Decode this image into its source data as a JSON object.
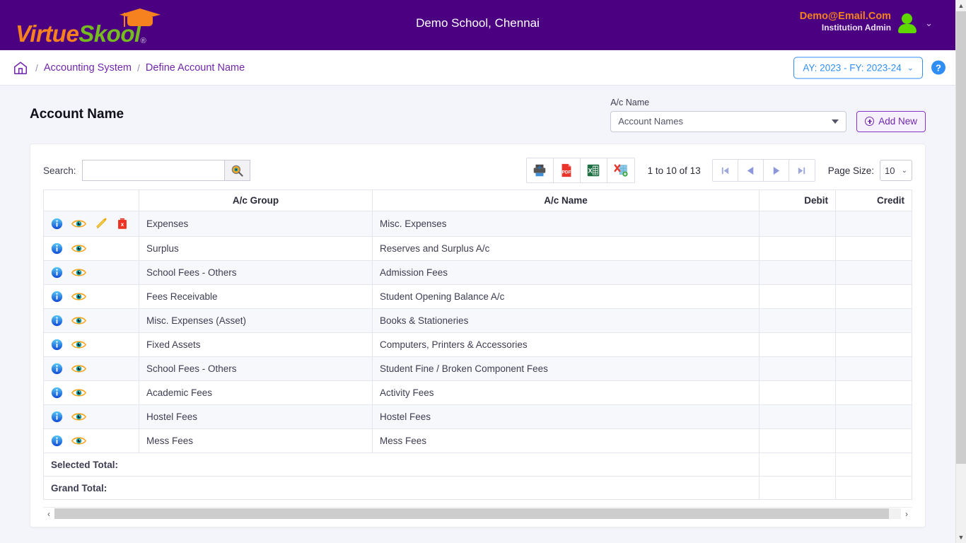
{
  "topbar": {
    "brand_part1": "Virtue",
    "brand_part2": "Skool",
    "brand_reg": "®",
    "school_title": "Demo School, Chennai",
    "user_email": "Demo@Email.Com",
    "user_role": "Institution Admin",
    "user_caret": "⌄"
  },
  "breadcrumb": {
    "home_label": "Home",
    "sep": "/",
    "item1": "Accounting System",
    "item2": "Define Account Name",
    "ay_label": "AY: 2023 - FY: 2023-24",
    "ay_caret": "⌄",
    "help_label": "?"
  },
  "page": {
    "title": "Account Name",
    "acname_field_label": "A/c Name",
    "acname_value": "Account Names",
    "add_new_label": "Add New"
  },
  "toolbar": {
    "search_label": "Search:",
    "search_value": "",
    "search_placeholder": "",
    "range_text": "1 to 10 of 13",
    "page_size_label": "Page Size:",
    "page_size_value": "10",
    "page_size_caret": "⌄",
    "export": [
      {
        "name": "print-icon",
        "title": "Print"
      },
      {
        "name": "pdf-icon",
        "title": "PDF"
      },
      {
        "name": "excel-icon",
        "title": "Excel"
      },
      {
        "name": "xml-export-icon",
        "title": "XML"
      }
    ],
    "pager": [
      {
        "name": "first-page-button",
        "label": "first"
      },
      {
        "name": "prev-page-button",
        "label": "prev"
      },
      {
        "name": "next-page-button",
        "label": "next"
      },
      {
        "name": "last-page-button",
        "label": "last"
      }
    ]
  },
  "table": {
    "columns": [
      "",
      "A/c Group",
      "A/c Name",
      "Debit",
      "Credit"
    ],
    "rows": [
      {
        "group": "Expenses",
        "name": "Misc. Expenses",
        "debit": "",
        "credit": "",
        "actions": [
          "info",
          "view",
          "edit",
          "delete"
        ]
      },
      {
        "group": "Surplus",
        "name": "Reserves and Surplus A/c",
        "debit": "",
        "credit": "",
        "actions": [
          "info",
          "view"
        ]
      },
      {
        "group": "School Fees - Others",
        "name": "Admission Fees",
        "debit": "",
        "credit": "",
        "actions": [
          "info",
          "view"
        ]
      },
      {
        "group": "Fees Receivable",
        "name": "Student Opening Balance A/c",
        "debit": "",
        "credit": "",
        "actions": [
          "info",
          "view"
        ]
      },
      {
        "group": "Misc. Expenses (Asset)",
        "name": "Books & Stationeries",
        "debit": "",
        "credit": "",
        "actions": [
          "info",
          "view"
        ]
      },
      {
        "group": "Fixed Assets",
        "name": "Computers, Printers & Accessories",
        "debit": "",
        "credit": "",
        "actions": [
          "info",
          "view"
        ]
      },
      {
        "group": "School Fees - Others",
        "name": "Student Fine / Broken Component Fees",
        "debit": "",
        "credit": "",
        "actions": [
          "info",
          "view"
        ]
      },
      {
        "group": "Academic Fees",
        "name": "Activity Fees",
        "debit": "",
        "credit": "",
        "actions": [
          "info",
          "view"
        ]
      },
      {
        "group": "Hostel Fees",
        "name": "Hostel Fees",
        "debit": "",
        "credit": "",
        "actions": [
          "info",
          "view"
        ]
      },
      {
        "group": "Mess Fees",
        "name": "Mess Fees",
        "debit": "",
        "credit": "",
        "actions": [
          "info",
          "view"
        ]
      }
    ],
    "selected_total_label": "Selected Total:",
    "grand_total_label": "Grand Total:",
    "selected_total_debit": "",
    "selected_total_credit": "",
    "grand_total_debit": "",
    "grand_total_credit": ""
  },
  "scroll": {
    "left_arrow": "‹",
    "right_arrow": "›",
    "up_arrow": "▲",
    "down_arrow": "▼"
  },
  "colors": {
    "brand_purple": "#4b0082",
    "brand_orange": "#f5821f",
    "brand_green": "#76bc21",
    "accent_blue": "#2f8ef4",
    "link_purple": "#7127ad",
    "page_bg": "#f4f5fa"
  }
}
